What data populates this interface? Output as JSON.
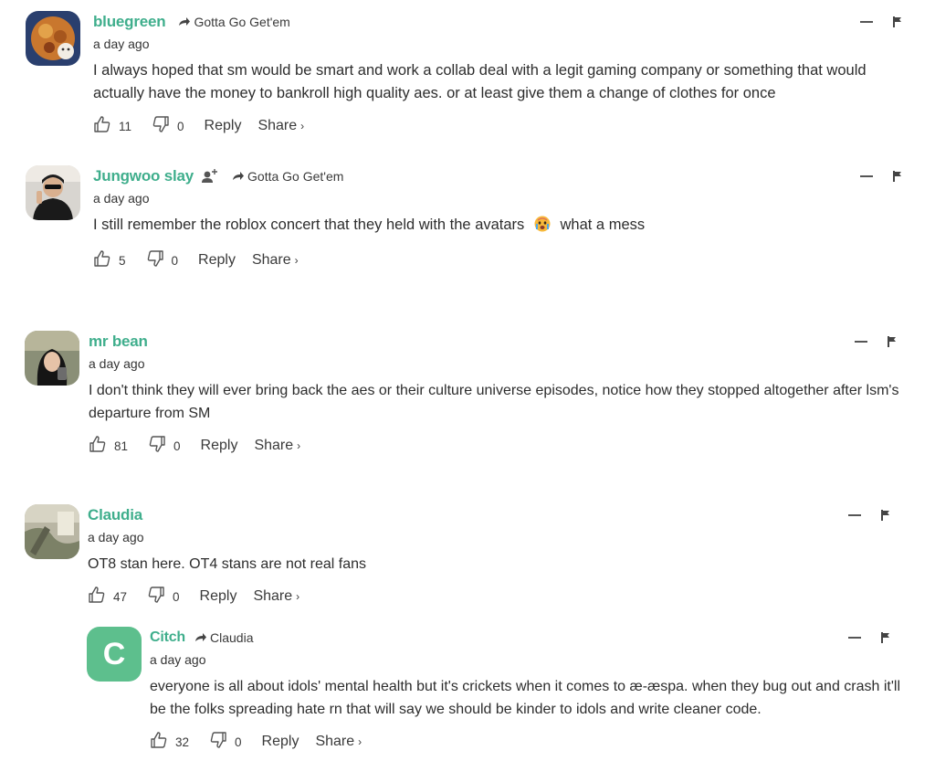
{
  "comments": [
    {
      "username": "bluegreen",
      "reply_to": "Gotta Go Get'em",
      "time": "a day ago",
      "text": "I always hoped that sm would be smart and work a collab deal with a legit gaming company or something that would actually have the money to bankroll high quality aes. or at least give them a change of clothes for once",
      "likes": "11",
      "dislikes": "0",
      "reply_label": "Reply",
      "share_label": "Share"
    },
    {
      "username": "Jungwoo slay",
      "reply_to": "Gotta Go Get'em",
      "time": "a day ago",
      "text_before": "I still remember the roblox concert that they held with the avatars",
      "text_after": "what a mess",
      "likes": "5",
      "dislikes": "0",
      "reply_label": "Reply",
      "share_label": "Share"
    },
    {
      "username": "mr bean",
      "time": "a day ago",
      "text": "I don't think they will ever bring back the aes or their culture universe episodes, notice how they stopped altogether after lsm's departure from SM",
      "likes": "81",
      "dislikes": "0",
      "reply_label": "Reply",
      "share_label": "Share"
    },
    {
      "username": "Claudia",
      "time": "a day ago",
      "text": "OT8 stan here. OT4 stans are not real fans",
      "likes": "47",
      "dislikes": "0",
      "reply_label": "Reply",
      "share_label": "Share"
    },
    {
      "username": "Citch",
      "avatar_letter": "C",
      "reply_to": "Claudia",
      "time": "a day ago",
      "text": "everyone is all about idols' mental health but it's crickets when it comes to æ-æspa. when they bug out and crash it'll be the folks spreading hate rn that will say we should be kinder to idols and write cleaner code.",
      "likes": "32",
      "dislikes": "0",
      "reply_label": "Reply",
      "share_label": "Share"
    }
  ],
  "share_chevron": "›",
  "colors": {
    "username": "#3fae8c",
    "citch_avatar": "#5dbf8d",
    "text": "#2d2d2d"
  },
  "icons": [
    "thumbs-up-icon",
    "thumbs-down-icon",
    "collapse-icon",
    "flag-icon",
    "reply-arrow-icon",
    "follow-user-icon",
    "crying-emoji-icon"
  ]
}
